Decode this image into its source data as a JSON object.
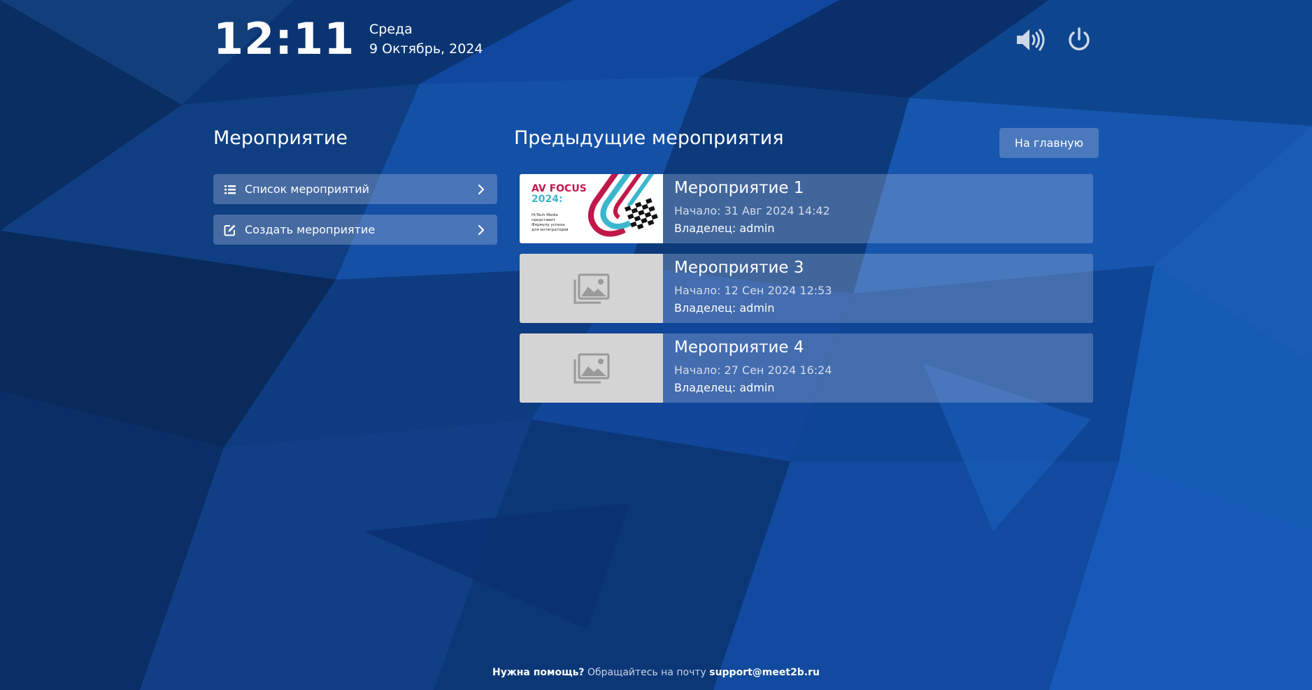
{
  "header": {
    "time": "12:11",
    "weekday": "Среда",
    "date": "9 Октябрь, 2024",
    "volume_icon": "volume-icon",
    "power_icon": "power-icon"
  },
  "left_panel": {
    "title": "Мероприятие",
    "items": [
      {
        "label": "Список мероприятий",
        "icon": "list-icon"
      },
      {
        "label": "Создать мероприятие",
        "icon": "edit-icon"
      }
    ]
  },
  "right_panel": {
    "title": "Предыдущие мероприятия",
    "home_button": "На главную",
    "events": [
      {
        "name": "Мероприятие 1",
        "start": "Начало: 31 Авг 2024 14:42",
        "owner": "Владелец: admin",
        "thumb": {
          "title_line1": "AV FOCUS",
          "title_line2": "2024:",
          "caption": [
            "Hi-Tech Media",
            "представит",
            "Формулу успеха",
            "для интеграторов"
          ]
        }
      },
      {
        "name": "Мероприятие 3",
        "start": "Начало: 12 Сен 2024 12:53",
        "owner": "Владелец: admin",
        "thumb": "image-placeholder-icon"
      },
      {
        "name": "Мероприятие 4",
        "start": "Начало: 27 Сен 2024 16:24",
        "owner": "Владелец: admin",
        "thumb": "image-placeholder-icon"
      }
    ]
  },
  "footer": {
    "help": "Нужна помощь?",
    "text": "Обращайтесь на почту",
    "email": "support@meet2b.ru"
  },
  "colors": {
    "background": "#0c3f86",
    "panel": "#a0b4d7",
    "av_focus_red": "#c0184a",
    "av_focus_cyan": "#3cb6cf",
    "placeholder": "#d4d4d4"
  }
}
